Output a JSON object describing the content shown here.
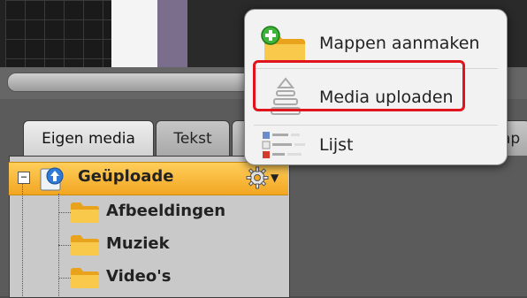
{
  "tabs": {
    "eigen_media": "Eigen media",
    "tekst": "Tekst",
    "right_partial": "ap"
  },
  "tree": {
    "root": "Geüploade",
    "folders": [
      "Afbeeldingen",
      "Muziek",
      "Video's"
    ],
    "expander": "−"
  },
  "menu": {
    "items": [
      "Mappen aanmaken",
      "Media uploaden",
      "Lijst"
    ]
  },
  "colors": {
    "selection": "#f2a623",
    "highlight_border": "#e0141c",
    "folder": "#f4b52a"
  }
}
